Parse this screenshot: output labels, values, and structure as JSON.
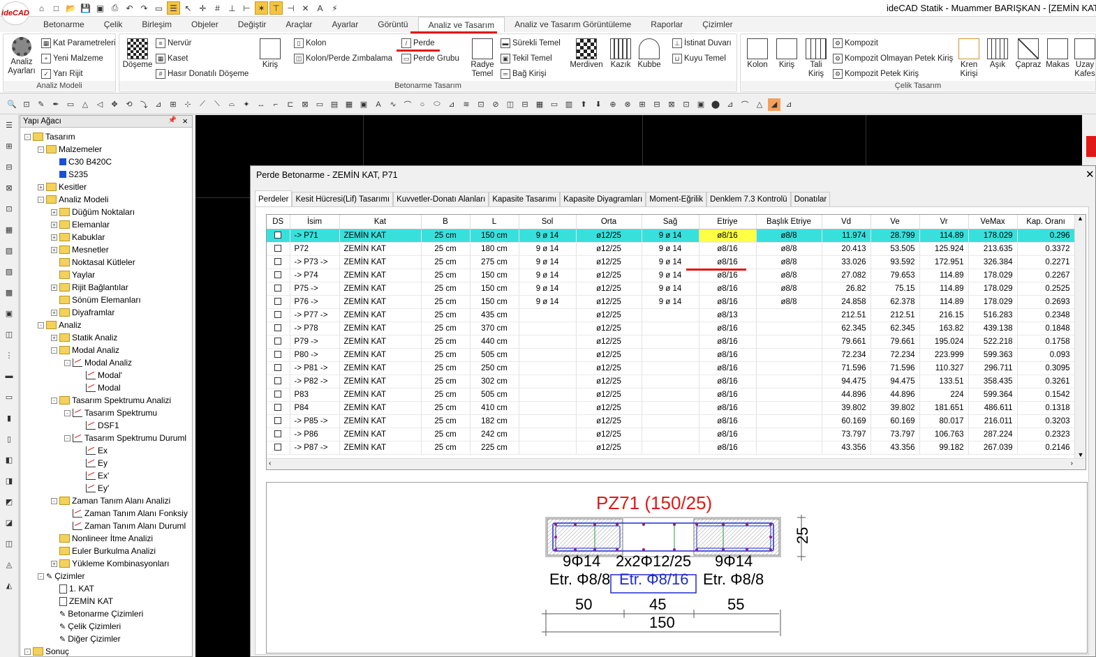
{
  "app": {
    "logo": "ideCAD",
    "title": "ideCAD Statik - Muammer BARIŞKAN - [ZEMİN KAT T"
  },
  "qat": [
    "home-icon",
    "new-icon",
    "open-icon",
    "save-icon",
    "save-as-icon",
    "print-icon",
    "undo-icon",
    "redo-icon",
    "screen-icon",
    "list-icon",
    "cursor-icon",
    "snap-icon",
    "grid-icon",
    "measure-icon",
    "ortho-icon",
    "polar-icon",
    "snap-end-icon",
    "snap-mid-icon",
    "snap-int-icon",
    "text-size-icon",
    "lightning-icon"
  ],
  "ribbon_tabs": [
    "Betonarme",
    "Çelik",
    "Birleşim",
    "Objeler",
    "Değiştir",
    "Araçlar",
    "Ayarlar",
    "Görüntü",
    "Analiz ve Tasarım",
    "Analiz ve Tasarım Görüntüleme",
    "Raporlar",
    "Çizimler"
  ],
  "ribbon_active": "Analiz ve Tasarım",
  "ribbon": {
    "analiz_modeli": {
      "label": "Analiz Modeli",
      "ayarlar": "Analiz Ayarları",
      "kat_param": "Kat Parametreleri",
      "yeni_malzeme": "Yeni Malzeme",
      "yari_rijit": "Yarı Rijit"
    },
    "betonarme": {
      "label": "Betonarme Tasarım",
      "doseme": "Döşeme",
      "nervur": "Nervür",
      "kaset": "Kaset",
      "hasir": "Hasır Donatılı Döşeme",
      "kiris": "Kiriş",
      "kolon": "Kolon",
      "kolon_perde": "Kolon/Perde Zımbalama",
      "perde": "Perde",
      "perde_grubu": "Perde Grubu",
      "radye": "Radye Temel",
      "surekli": "Sürekli Temel",
      "tekil": "Tekil Temel",
      "bag": "Bağ Kirişi",
      "merdiven": "Merdiven",
      "kazik": "Kazık",
      "kubbe": "Kubbe",
      "istinat": "İstinat Duvarı",
      "kuyu": "Kuyu Temel"
    },
    "celik": {
      "label": "Çelik Tasarım",
      "kolon": "Kolon",
      "kiris": "Kiriş",
      "tali": "Tali Kiriş",
      "kompozit": "Kompozit",
      "kompozit_olmayan": "Kompozit Olmayan Petek Kiriş",
      "kompozit_petek": "Kompozit Petek Kiriş",
      "kren": "Kren Kirişi",
      "asik": "Aşık",
      "capraz": "Çapraz",
      "makas": "Makas",
      "uzay": "Uzay Kafes"
    }
  },
  "tree": {
    "title": "Yapı Ağacı",
    "nodes": [
      {
        "t": "Tasarım",
        "lvl": 0,
        "exp": "-",
        "icon": "tree-root-icon"
      },
      {
        "t": "Malzemeler",
        "lvl": 1,
        "exp": "-",
        "icon": "folder-icon"
      },
      {
        "t": "C30 B420C",
        "lvl": 2,
        "exp": "",
        "icon": "material-icon"
      },
      {
        "t": "S235",
        "lvl": 2,
        "exp": "",
        "icon": "material-icon"
      },
      {
        "t": "Kesitler",
        "lvl": 1,
        "exp": "+",
        "icon": "folder-icon"
      },
      {
        "t": "Analiz Modeli",
        "lvl": 1,
        "exp": "-",
        "icon": "folder-icon"
      },
      {
        "t": "Düğüm Noktaları",
        "lvl": 2,
        "exp": "+",
        "icon": "folder-icon"
      },
      {
        "t": "Elemanlar",
        "lvl": 2,
        "exp": "+",
        "icon": "folder-icon"
      },
      {
        "t": "Kabuklar",
        "lvl": 2,
        "exp": "+",
        "icon": "folder-icon"
      },
      {
        "t": "Mesnetler",
        "lvl": 2,
        "exp": "+",
        "icon": "folder-icon"
      },
      {
        "t": "Noktasal Kütleler",
        "lvl": 2,
        "exp": "",
        "icon": "folder-icon"
      },
      {
        "t": "Yaylar",
        "lvl": 2,
        "exp": "",
        "icon": "folder-icon"
      },
      {
        "t": "Rijit Bağlantılar",
        "lvl": 2,
        "exp": "+",
        "icon": "folder-icon"
      },
      {
        "t": "Sönüm Elemanları",
        "lvl": 2,
        "exp": "",
        "icon": "folder-icon"
      },
      {
        "t": "Diyaframlar",
        "lvl": 2,
        "exp": "+",
        "icon": "folder-icon"
      },
      {
        "t": "Analiz",
        "lvl": 1,
        "exp": "-",
        "icon": "folder-icon"
      },
      {
        "t": "Statik Analiz",
        "lvl": 2,
        "exp": "+",
        "icon": "folder-icon"
      },
      {
        "t": "Modal Analiz",
        "lvl": 2,
        "exp": "-",
        "icon": "folder-icon"
      },
      {
        "t": "Modal Analiz",
        "lvl": 3,
        "exp": "-",
        "icon": "chart-icon"
      },
      {
        "t": "Modal'",
        "lvl": 4,
        "exp": "",
        "icon": "chart-icon"
      },
      {
        "t": "Modal",
        "lvl": 4,
        "exp": "",
        "icon": "chart-icon"
      },
      {
        "t": "Tasarım Spektrumu Analizi",
        "lvl": 2,
        "exp": "-",
        "icon": "folder-icon"
      },
      {
        "t": "Tasarım Spektrumu",
        "lvl": 3,
        "exp": "-",
        "icon": "chart-icon"
      },
      {
        "t": "DSF1",
        "lvl": 4,
        "exp": "",
        "icon": "chart-icon"
      },
      {
        "t": "Tasarım Spektrumu Duruml",
        "lvl": 3,
        "exp": "-",
        "icon": "chart-icon"
      },
      {
        "t": "Ex",
        "lvl": 4,
        "exp": "",
        "icon": "chart-icon"
      },
      {
        "t": "Ey",
        "lvl": 4,
        "exp": "",
        "icon": "chart-icon"
      },
      {
        "t": "Ex'",
        "lvl": 4,
        "exp": "",
        "icon": "chart-icon"
      },
      {
        "t": "Ey'",
        "lvl": 4,
        "exp": "",
        "icon": "chart-icon"
      },
      {
        "t": "Zaman Tanım Alanı Analizi",
        "lvl": 2,
        "exp": "-",
        "icon": "folder-icon"
      },
      {
        "t": "Zaman Tanım Alanı Fonksiy",
        "lvl": 3,
        "exp": "",
        "icon": "chart-icon"
      },
      {
        "t": "Zaman Tanım Alanı Duruml",
        "lvl": 3,
        "exp": "",
        "icon": "chart-icon"
      },
      {
        "t": "Nonlineer İtme Analizi",
        "lvl": 2,
        "exp": "",
        "icon": "folder-icon"
      },
      {
        "t": "Euler Burkulma Analizi",
        "lvl": 2,
        "exp": "",
        "icon": "folder-icon"
      },
      {
        "t": "Yükleme Kombinasyonları",
        "lvl": 2,
        "exp": "+",
        "icon": "folder-icon"
      },
      {
        "t": "Çizimler",
        "lvl": 1,
        "exp": "-",
        "icon": "drawings-icon"
      },
      {
        "t": "1. KAT",
        "lvl": 2,
        "exp": "",
        "icon": "document-icon"
      },
      {
        "t": "ZEMİN KAT",
        "lvl": 2,
        "exp": "",
        "icon": "document-icon"
      },
      {
        "t": "Betonarme Çizimleri",
        "lvl": 2,
        "exp": "",
        "icon": "drawings-icon"
      },
      {
        "t": "Çelik Çizimleri",
        "lvl": 2,
        "exp": "",
        "icon": "drawings-icon"
      },
      {
        "t": "Diğer Çizimler",
        "lvl": 2,
        "exp": "",
        "icon": "drawings-icon"
      },
      {
        "t": "Sonuç",
        "lvl": 0,
        "exp": "-",
        "icon": "folder-icon"
      }
    ]
  },
  "dialog": {
    "title": "Perde Betonarme - ZEMİN KAT, P71",
    "tabs": [
      "Perdeler",
      "Kesit Hücresi(Lif) Tasarımı",
      "Kuvvetler-Donatı Alanları",
      "Kapasite Tasarımı",
      "Kapasite Diyagramları",
      "Moment-Eğrilik",
      "Denklem 7.3 Kontrolü",
      "Donatılar"
    ],
    "columns": [
      "DS",
      "İsim",
      "Kat",
      "B",
      "L",
      "Sol",
      "Orta",
      "Sağ",
      "Etriye",
      "Başlık Etriye",
      "Vd",
      "Ve",
      "Vr",
      "VeMax",
      "Kap. Oranı"
    ],
    "rows": [
      [
        "",
        "-> P71",
        "ZEMİN KAT",
        "25 cm",
        "150 cm",
        "9 ø 14",
        "ø12/25",
        "9 ø 14",
        "ø8/16",
        "ø8/8",
        "11.974",
        "28.799",
        "114.89",
        "178.029",
        "0.296"
      ],
      [
        "",
        "P72",
        "ZEMİN KAT",
        "25 cm",
        "180 cm",
        "9 ø 14",
        "ø12/25",
        "9 ø 14",
        "ø8/16",
        "ø8/8",
        "20.413",
        "53.505",
        "125.924",
        "213.635",
        "0.3372"
      ],
      [
        "",
        "-> P73 ->",
        "ZEMİN KAT",
        "25 cm",
        "275 cm",
        "9 ø 14",
        "ø12/25",
        "9 ø 14",
        "ø8/16",
        "ø8/8",
        "33.026",
        "93.592",
        "172.951",
        "326.384",
        "0.2271"
      ],
      [
        "",
        "-> P74",
        "ZEMİN KAT",
        "25 cm",
        "150 cm",
        "9 ø 14",
        "ø12/25",
        "9 ø 14",
        "ø8/16",
        "ø8/8",
        "27.082",
        "79.653",
        "114.89",
        "178.029",
        "0.2267"
      ],
      [
        "",
        "P75 ->",
        "ZEMİN KAT",
        "25 cm",
        "150 cm",
        "9 ø 14",
        "ø12/25",
        "9 ø 14",
        "ø8/16",
        "ø8/8",
        "26.82",
        "75.15",
        "114.89",
        "178.029",
        "0.2525"
      ],
      [
        "",
        "P76 ->",
        "ZEMİN KAT",
        "25 cm",
        "150 cm",
        "9 ø 14",
        "ø12/25",
        "9 ø 14",
        "ø8/16",
        "ø8/8",
        "24.858",
        "62.378",
        "114.89",
        "178.029",
        "0.2693"
      ],
      [
        "",
        "-> P77 ->",
        "ZEMİN KAT",
        "25 cm",
        "435 cm",
        "",
        "ø12/25",
        "",
        "ø8/13",
        "",
        "212.51",
        "212.51",
        "216.15",
        "516.283",
        "0.2348"
      ],
      [
        "",
        "-> P78",
        "ZEMİN KAT",
        "25 cm",
        "370 cm",
        "",
        "ø12/25",
        "",
        "ø8/16",
        "",
        "62.345",
        "62.345",
        "163.82",
        "439.138",
        "0.1848"
      ],
      [
        "",
        "P79 ->",
        "ZEMİN KAT",
        "25 cm",
        "440 cm",
        "",
        "ø12/25",
        "",
        "ø8/16",
        "",
        "79.661",
        "79.661",
        "195.024",
        "522.218",
        "0.1758"
      ],
      [
        "",
        "P80 ->",
        "ZEMİN KAT",
        "25 cm",
        "505 cm",
        "",
        "ø12/25",
        "",
        "ø8/16",
        "",
        "72.234",
        "72.234",
        "223.999",
        "599.363",
        "0.093"
      ],
      [
        "",
        "-> P81 ->",
        "ZEMİN KAT",
        "25 cm",
        "250 cm",
        "",
        "ø12/25",
        "",
        "ø8/16",
        "",
        "71.596",
        "71.596",
        "110.327",
        "296.711",
        "0.3095"
      ],
      [
        "",
        "-> P82 ->",
        "ZEMİN KAT",
        "25 cm",
        "302 cm",
        "",
        "ø12/25",
        "",
        "ø8/16",
        "",
        "94.475",
        "94.475",
        "133.51",
        "358.435",
        "0.3261"
      ],
      [
        "",
        "P83",
        "ZEMİN KAT",
        "25 cm",
        "505 cm",
        "",
        "ø12/25",
        "",
        "ø8/16",
        "",
        "44.896",
        "44.896",
        "224",
        "599.364",
        "0.1542"
      ],
      [
        "",
        "P84",
        "ZEMİN KAT",
        "25 cm",
        "410 cm",
        "",
        "ø12/25",
        "",
        "ø8/16",
        "",
        "39.802",
        "39.802",
        "181.651",
        "486.611",
        "0.1318"
      ],
      [
        "",
        "-> P85 ->",
        "ZEMİN KAT",
        "25 cm",
        "182 cm",
        "",
        "ø12/25",
        "",
        "ø8/16",
        "",
        "60.169",
        "60.169",
        "80.017",
        "216.011",
        "0.3203"
      ],
      [
        "",
        "-> P86",
        "ZEMİN KAT",
        "25 cm",
        "242 cm",
        "",
        "ø12/25",
        "",
        "ø8/16",
        "",
        "73.797",
        "73.797",
        "106.763",
        "287.224",
        "0.2323"
      ],
      [
        "",
        "-> P87 ->",
        "ZEMİN KAT",
        "25 cm",
        "225 cm",
        "",
        "ø12/25",
        "",
        "ø8/16",
        "",
        "43.356",
        "43.356",
        "99.182",
        "267.039",
        "0.2146"
      ]
    ]
  },
  "section": {
    "title": "PZ71 (150/25)",
    "left_rebar": "9Φ14",
    "mid_rebar": "2x2Φ12/25",
    "right_rebar": "9Φ14",
    "left_stirrup": "Etr. Φ8/8",
    "mid_stirrup": "Etr. Φ8/16",
    "right_stirrup": "Etr. Φ8/8",
    "dim_left": "50",
    "dim_mid": "45",
    "dim_right": "55",
    "dim_total": "150",
    "dim_height": "25"
  },
  "colors": {
    "accent_red": "#e01818",
    "selected_row": "#38e0dc",
    "highlight_cell": "#ffff44",
    "title_red": "#e01818"
  }
}
